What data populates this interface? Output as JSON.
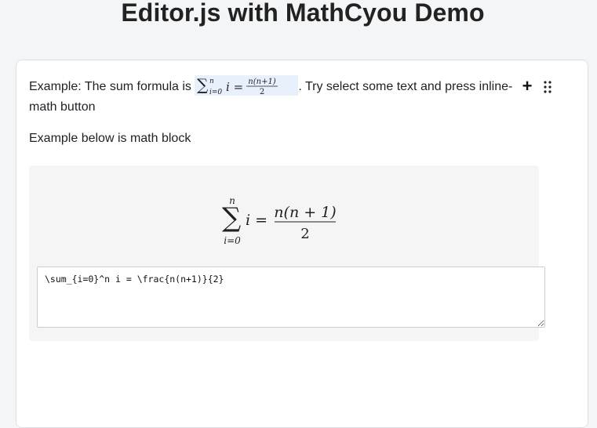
{
  "page": {
    "title": "Editor.js with MathCyou Demo"
  },
  "editor": {
    "paragraph1": {
      "before": "Example: The sum formula is ",
      "after": ". Try select some text and press inline-math button",
      "inline_math_latex": "\\sum_{i=0}^n i = \\frac{n(n+1)}{2}"
    },
    "paragraph2": {
      "text": "Example below is math block"
    },
    "math_block": {
      "latex": "\\sum_{i=0}^n i = \\frac{n(n+1)}{2}",
      "rendered": {
        "sum_upper": "n",
        "sum_lower": "i=0",
        "body": "i =",
        "numerator": "n(n + 1)",
        "denominator": "2"
      }
    },
    "inline_rendered": {
      "sum_upper": "n",
      "sum_lower": "i=0",
      "body": "i =",
      "numerator": "n(n+1)",
      "denominator": "2"
    },
    "toolbar": {
      "plus_icon": "plus-icon",
      "drag_icon": "drag-handle-icon"
    }
  }
}
